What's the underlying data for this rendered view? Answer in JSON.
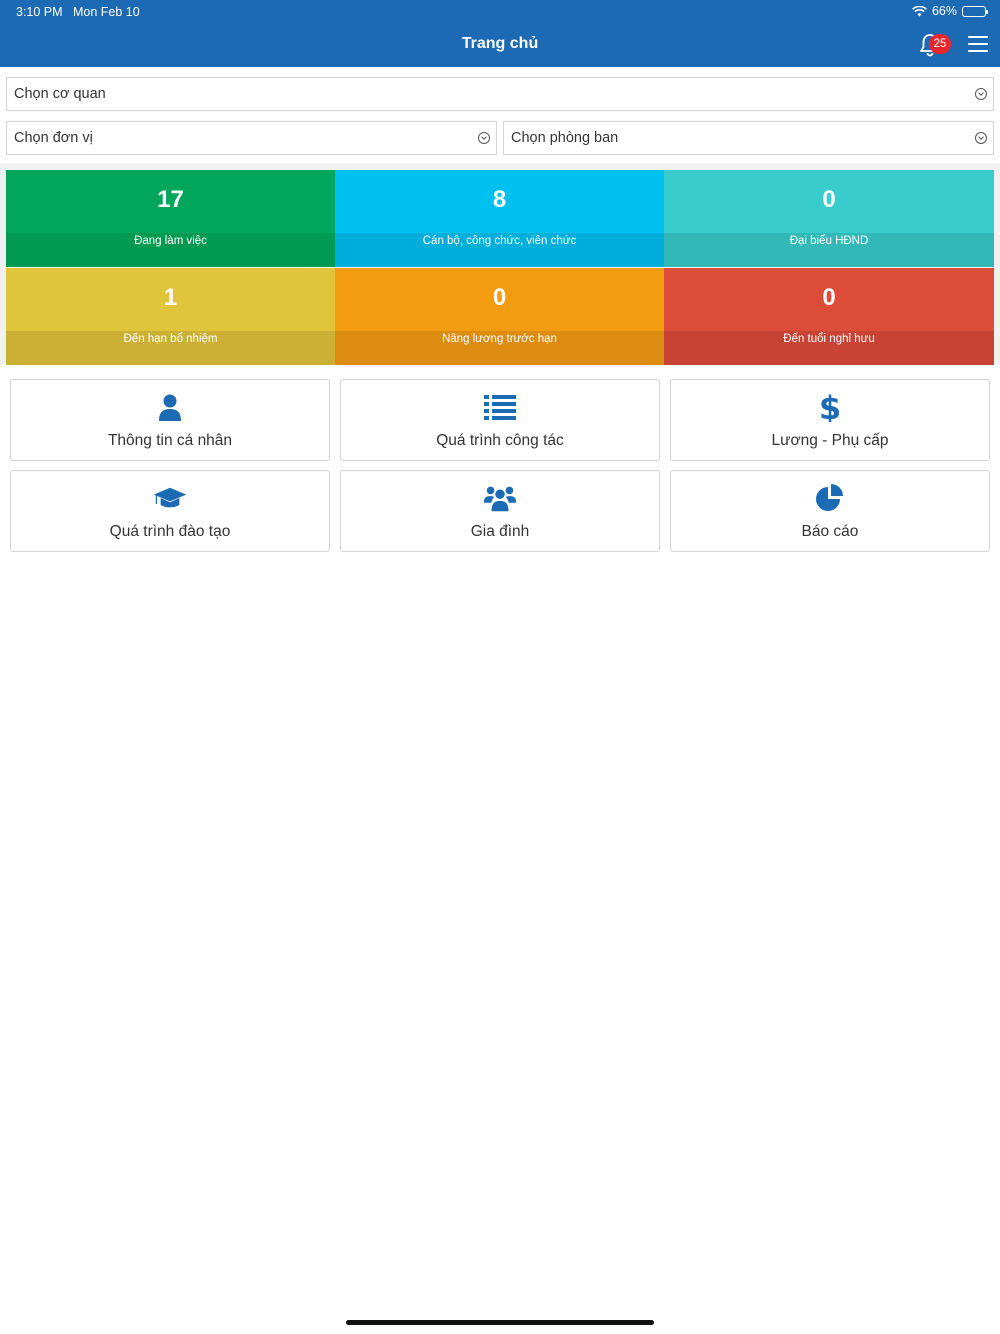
{
  "status": {
    "time": "3:10 PM",
    "date": "Mon Feb 10",
    "battery": "66%"
  },
  "header": {
    "title": "Trang chủ",
    "notification_count": "25"
  },
  "filters": {
    "agency": "Chọn cơ quan",
    "unit": "Chọn đơn vị",
    "department": "Chọn phòng ban"
  },
  "stats": [
    {
      "value": "17",
      "label": "Đang làm việc",
      "color": "#00a65a",
      "footer_color": "#009a50"
    },
    {
      "value": "8",
      "label": "Cán bộ, công chức, viên chức",
      "color": "#00c0ef",
      "footer_color": "#00aedb"
    },
    {
      "value": "0",
      "label": "Đại biểu HĐND",
      "color": "#39cccc",
      "footer_color": "#33b8b8"
    },
    {
      "value": "1",
      "label": "Đến hạn bổ nhiệm",
      "color": "#e0c43a",
      "footer_color": "#ccb036"
    },
    {
      "value": "0",
      "label": "Nâng lương trước hạn",
      "color": "#f39c12",
      "footer_color": "#dc8c10"
    },
    {
      "value": "0",
      "label": "Đến tuổi nghỉ hưu",
      "color": "#dd4b39",
      "footer_color": "#c74334"
    }
  ],
  "menu": [
    {
      "label": "Thông tin cá nhân",
      "icon": "user-icon"
    },
    {
      "label": "Quá trình công tác",
      "icon": "list-icon"
    },
    {
      "label": "Lương - Phụ cấp",
      "icon": "dollar-icon"
    },
    {
      "label": "Quá trình đào tạo",
      "icon": "graduation-cap-icon"
    },
    {
      "label": "Gia đình",
      "icon": "users-icon"
    },
    {
      "label": "Báo cáo",
      "icon": "pie-chart-icon"
    }
  ],
  "colors": {
    "primary": "#1c6ab3",
    "icon": "#1c6ab3",
    "badge": "#e8262b"
  }
}
